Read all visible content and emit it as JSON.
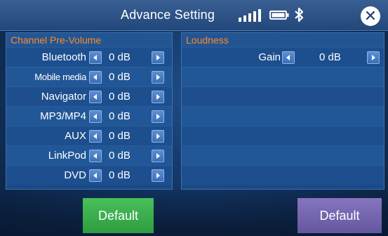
{
  "header": {
    "title": "Advance Setting"
  },
  "status": {
    "signal_icon": "signal-bars-icon",
    "battery_icon": "battery-icon",
    "bluetooth_icon": "bluetooth-icon"
  },
  "left_panel": {
    "title": "Channel Pre-Volume",
    "rows": [
      {
        "label": "Bluetooth",
        "value": "0 dB"
      },
      {
        "label": "Mobile media",
        "value": "0 dB"
      },
      {
        "label": "Navigator",
        "value": "0 dB"
      },
      {
        "label": "MP3/MP4",
        "value": "0 dB"
      },
      {
        "label": "AUX",
        "value": "0 dB"
      },
      {
        "label": "LinkPod",
        "value": "0 dB"
      },
      {
        "label": "DVD",
        "value": "0 dB"
      }
    ],
    "default_label": "Default"
  },
  "right_panel": {
    "title": "Loudness",
    "rows": [
      {
        "label": "Gain",
        "value": "0 dB"
      }
    ],
    "default_label": "Default"
  },
  "colors": {
    "accent_orange": "#ff8a2a",
    "default_left": "#3fb150",
    "default_right": "#7868b2"
  }
}
